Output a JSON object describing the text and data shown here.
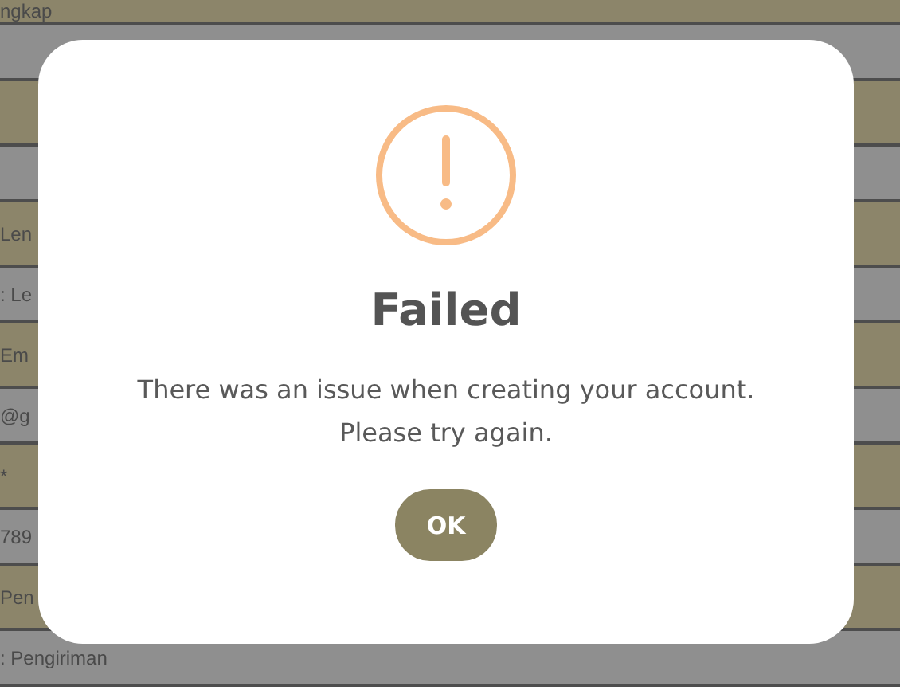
{
  "background_rows": [
    {
      "kind": "label",
      "text": "ngkap"
    },
    {
      "kind": "value"
    },
    {
      "kind": "label"
    },
    {
      "kind": "value"
    },
    {
      "kind": "label",
      "text": "Len"
    },
    {
      "kind": "value",
      "text": ": Le"
    },
    {
      "kind": "label",
      "text": "Em"
    },
    {
      "kind": "value",
      "text": "@g"
    },
    {
      "kind": "label",
      "text": "*"
    },
    {
      "kind": "value",
      "text": "789"
    },
    {
      "kind": "label",
      "text": "Pen"
    },
    {
      "kind": "value",
      "text": ": Pengiriman"
    }
  ],
  "dialog": {
    "title": "Failed",
    "message": "There was an issue when creating your account. Please try again.",
    "button": "OK"
  }
}
